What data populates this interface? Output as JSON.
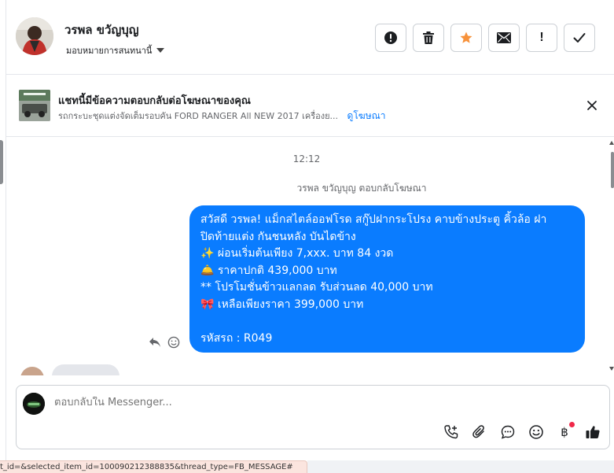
{
  "header": {
    "contact_name": "วรพล ขวัญบุญ",
    "assign_label": "มอบหมายการสนทนานี้",
    "toolbar": [
      {
        "name": "spam-button",
        "icon": "alert-circle-icon"
      },
      {
        "name": "delete-button",
        "icon": "trash-icon"
      },
      {
        "name": "star-button",
        "icon": "star-icon",
        "color": "#f7923b"
      },
      {
        "name": "mark-unread-button",
        "icon": "envelope-icon"
      },
      {
        "name": "follow-up-button",
        "icon": "exclamation-icon",
        "label": "!"
      },
      {
        "name": "done-button",
        "icon": "check-icon"
      }
    ]
  },
  "ad_banner": {
    "title": "แชทนี้มีข้อความตอบกลับต่อโฆษณาของคุณ",
    "description": "รถกระบะชุดแต่งจัดเต็มรอบคัน FORD RANGER All NEW 2017 เครื่องย...",
    "link": "ดูโฆษณา"
  },
  "conversation": {
    "timestamp": "12:12",
    "reply_note": "วรพล ขวัญบุญ ตอบกลับโฆษณา",
    "message_lines": [
      "สวัสดี วรพล! แม็กสไตล์ออฟโรด สกู๊ปฝากระโปรง คาบข้างประตู คิ้วล้อ ฝา",
      "ปิดท้ายแต่ง กันชนหลัง บันไดข้าง",
      "✨  ผ่อนเริ่มต้นเพียง 7,xxx. บาท 84 งวด",
      "🛎️ ราคาปกติ 439,000 บาท",
      "** โปรโมชั่นข้าวแลกลด รับส่วนลด 40,000 บาท",
      "🎀  เหลือเพียงราคา 399,000 บาท",
      "",
      " รหัสรถ : R049"
    ],
    "bubble_color": "#0a7cff"
  },
  "composer": {
    "placeholder": "ตอบกลับใน Messenger...",
    "baht_symbol": "฿"
  },
  "status_bar": {
    "url_text": "t_id=&selected_item_id=100090212388835&thread_type=FB_MESSAGE#"
  }
}
